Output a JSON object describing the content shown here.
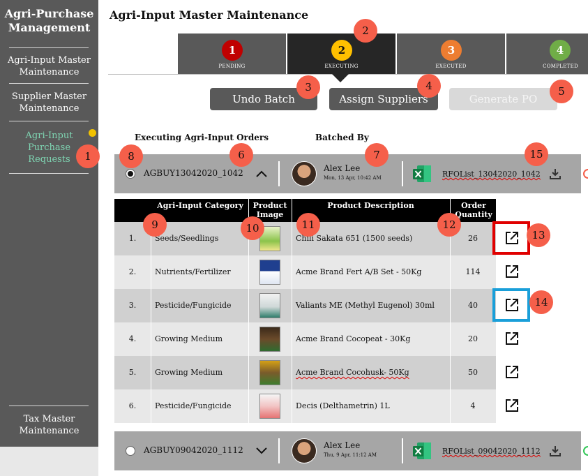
{
  "sidebar": {
    "title": "Agri-Purchase Management",
    "items": [
      {
        "label": "Agri-Input Master Maintenance"
      },
      {
        "label": "Supplier Master Maintenance"
      },
      {
        "label": "Agri-Input Purchase Requests"
      },
      {
        "label": "Tax Master Maintenance"
      }
    ]
  },
  "page_title": "Agri-Input Master Maintenance",
  "stepper": [
    {
      "number": "1",
      "label": "PENDING",
      "color": "#c00000"
    },
    {
      "number": "2",
      "label": "EXECUTING",
      "color": "#ffc000"
    },
    {
      "number": "3",
      "label": "EXECUTED",
      "color": "#ed7d31"
    },
    {
      "number": "4",
      "label": "COMPLETED",
      "color": "#70ad47"
    }
  ],
  "buttons": {
    "undo": "Undo Batch",
    "assign": "Assign Suppliers",
    "generate": "Generate PO"
  },
  "headings": {
    "orders": "Executing Agri-Input Orders",
    "batched_by": "Batched By"
  },
  "batches": [
    {
      "id": "AGBUY13042020_1042",
      "chevron": "^",
      "user": "Alex Lee",
      "time": "Mon, 13 Apr, 10:42 AM",
      "file": "RFOList_13042020_1042"
    },
    {
      "id": "AGBUY09042020_1112",
      "chevron": "v",
      "user": "Alex Lee",
      "time": "Thu, 9 Apr, 11:12 AM",
      "file": "RFOList_09042020_1112"
    }
  ],
  "table": {
    "headers": {
      "category": "Agri-Input Category",
      "image": "Product Image",
      "description": "Product Description",
      "quantity": "Order Quantity"
    },
    "rows": [
      {
        "num": "1.",
        "category": "Seeds/Seedlings",
        "description": "Chili Sakata 651 (1500 seeds)",
        "qty": "26"
      },
      {
        "num": "2.",
        "category": "Nutrients/Fertilizer",
        "description": "Acme Brand Fert A/B Set - 50Kg",
        "qty": "114"
      },
      {
        "num": "3.",
        "category": "Pesticide/Fungicide",
        "description": "Valiants ME (Methyl Eugenol) 30ml",
        "qty": "40"
      },
      {
        "num": "4.",
        "category": "Growing Medium",
        "description": "Acme Brand Cocopeat - 30Kg",
        "qty": "20"
      },
      {
        "num": "5.",
        "category": "Growing Medium",
        "description": "Acme Brand Cocohusk-  50Kg",
        "qty": "50"
      },
      {
        "num": "6.",
        "category": "Pesticide/Fungicide",
        "description": "Decis (Delthametrin) 1L",
        "qty": "4"
      }
    ]
  },
  "annotations": [
    "1",
    "2",
    "3",
    "4",
    "5",
    "6",
    "7",
    "8",
    "9",
    "10",
    "11",
    "12",
    "13",
    "14",
    "15"
  ],
  "colors": {
    "badge": "#f55f4a",
    "sidebar": "#595959",
    "active_item": "#7fd6b3",
    "highlight_red": "#e00000",
    "highlight_blue": "#1a9fd9"
  }
}
